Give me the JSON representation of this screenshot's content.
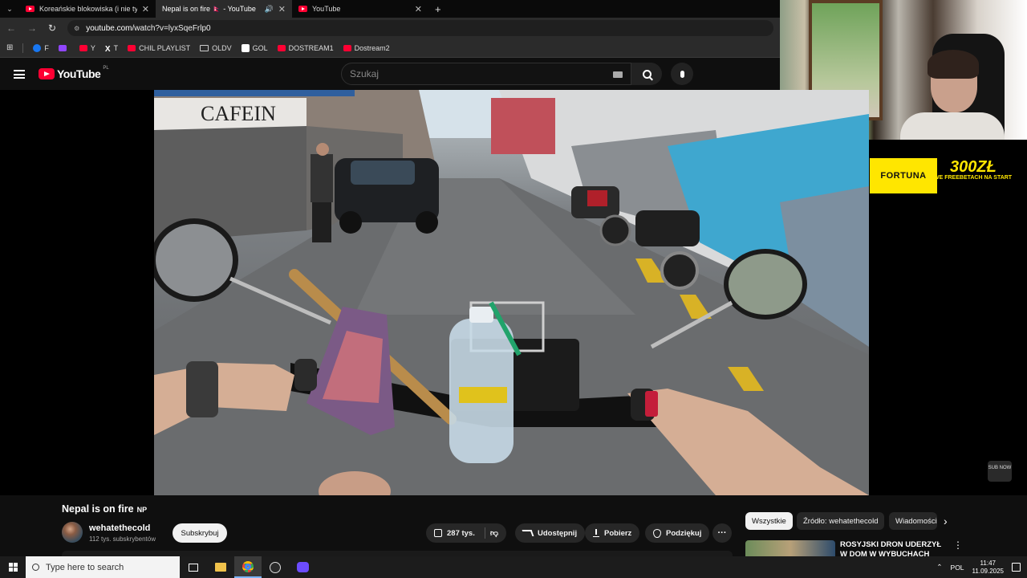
{
  "browser": {
    "tabs": [
      {
        "title": "Koreańskie blokowiska (i nie tylko)",
        "active": false
      },
      {
        "title": "Nepal is on fire 🇳🇵 - YouTube",
        "active": true
      },
      {
        "title": "YouTube",
        "active": false
      }
    ],
    "new_tab": "+",
    "url_host": "youtube.com",
    "url_path": "/watch?v=lyxSqeFrlp0",
    "bookmarks": [
      "F",
      "",
      "Y",
      "T",
      "CHIL PLAYLIST",
      "OLDV",
      "GOL",
      "DOSTREAM1",
      "Dostream2"
    ]
  },
  "youtube": {
    "logo_text": "YouTube",
    "country": "PL",
    "search_placeholder": "Szukaj"
  },
  "overlay": {
    "fortuna": "FORTUNA",
    "promo_amount": "300ZŁ",
    "promo_text": "WE FREEBETACH NA START",
    "sub_now": "SUB NOW"
  },
  "video": {
    "title": "Nepal is on fire",
    "title_flag": "NP",
    "channel": "wehatethecold",
    "subscribers": "112 tys. subskrybentów",
    "subscribe_label": "Subskrybuj",
    "likes": "287 tys.",
    "share_label": "Udostępnij",
    "download_label": "Pobierz",
    "thanks_label": "Podziękuj",
    "more_label": "···"
  },
  "sidebar": {
    "chips": [
      "Wszystkie",
      "Źródło: wehatethecold",
      "Wiadomości"
    ],
    "rec_title": "ROSYJSKI DRON UDERZYŁ W DOM W WYBUCHACH"
  },
  "taskbar": {
    "search_placeholder": "Type here to search",
    "language": "POL",
    "time": "11:47",
    "date": "11.09.2025"
  },
  "colors": {
    "accent": "#ff0033",
    "fortuna": "#ffe600",
    "bg": "#0f0f0f"
  }
}
